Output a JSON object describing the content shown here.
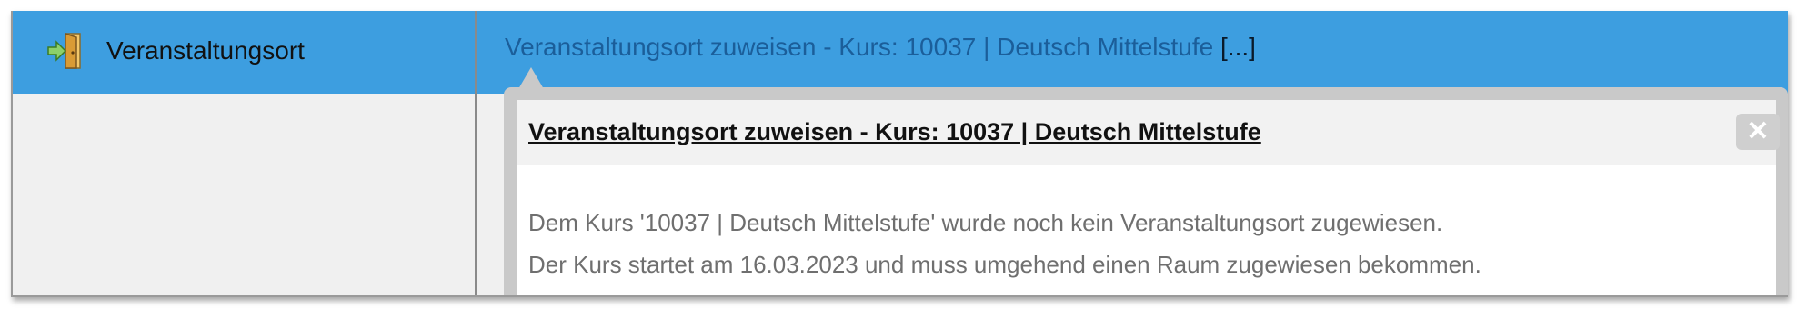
{
  "row": {
    "label": "Veranstaltungsort",
    "icon": "door-exit-icon"
  },
  "header": {
    "link_text": "Veranstaltungsort zuweisen - Kurs: 10037 | Deutsch Mittelstufe",
    "ellipsis": "[...]",
    "accent_color": "#3d9ee0"
  },
  "popup": {
    "title": "Veranstaltungsort zuweisen - Kurs: 10037 | Deutsch Mittelstufe",
    "close_symbol": "✕",
    "body_lines": [
      "Dem Kurs '10037 | Deutsch Mittelstufe' wurde noch kein Veranstaltungsort zugewiesen.",
      "Der Kurs startet am 16.03.2023 und muss umgehend einen Raum zugewiesen bekommen."
    ]
  }
}
